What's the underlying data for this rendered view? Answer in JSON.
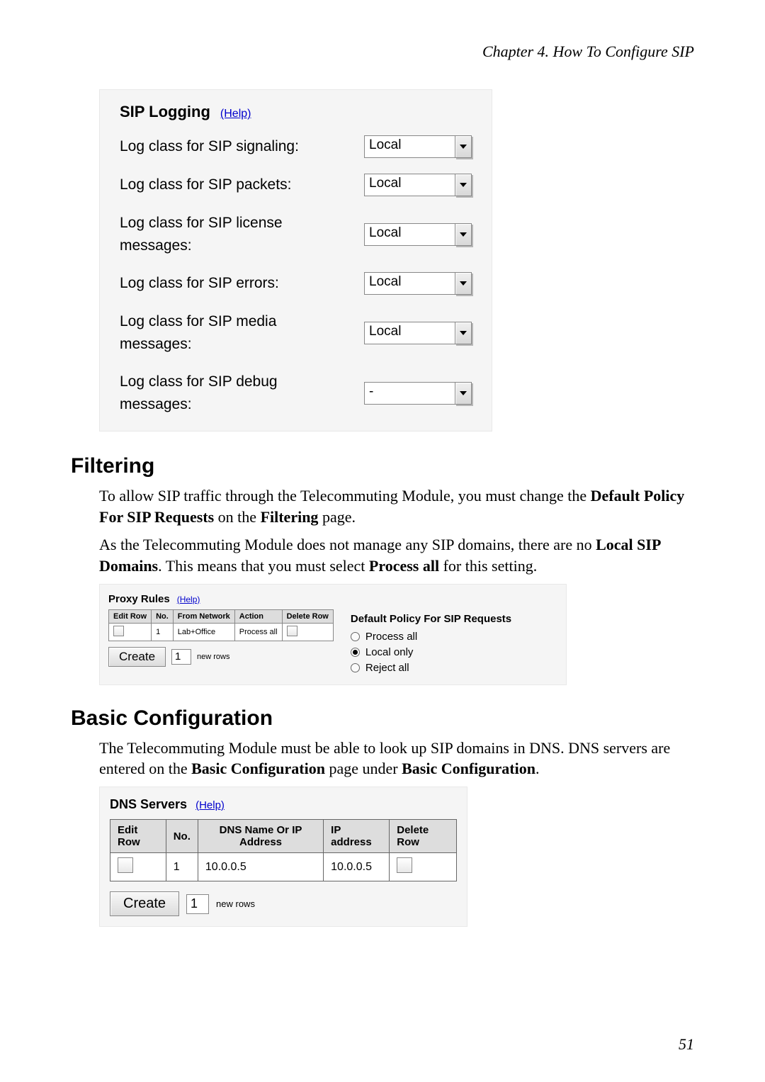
{
  "chapter": "Chapter 4. How To Configure SIP",
  "sip_logging": {
    "title": "SIP Logging",
    "help": "(Help)",
    "rows": [
      {
        "label": "Log class for SIP signaling:",
        "value": "Local"
      },
      {
        "label": "Log class for SIP packets:",
        "value": "Local"
      },
      {
        "label": "Log class for SIP license messages:",
        "value": "Local"
      },
      {
        "label": "Log class for SIP errors:",
        "value": "Local"
      },
      {
        "label": "Log class for SIP media messages:",
        "value": "Local"
      },
      {
        "label": "Log class for SIP debug messages:",
        "value": "-"
      }
    ]
  },
  "filtering": {
    "heading": "Filtering",
    "p1_a": "To allow SIP traffic through the Telecommuting Module, you must change the ",
    "p1_b": "Default Policy For SIP Requests",
    "p1_c": " on the ",
    "p1_d": "Filtering",
    "p1_e": " page.",
    "p2_a": "As the Telecommuting Module does not manage any SIP domains, there are no ",
    "p2_b": "Local SIP Domains",
    "p2_c": ". This means that you must select ",
    "p2_d": "Process all",
    "p2_e": " for this setting."
  },
  "proxy": {
    "title": "Proxy Rules",
    "help": "(Help)",
    "headers": {
      "edit": "Edit Row",
      "no": "No.",
      "from": "From Network",
      "action": "Action",
      "delete": "Delete Row"
    },
    "row": {
      "no": "1",
      "from": "Lab+Office",
      "action": "Process all"
    },
    "create": "Create",
    "create_num": "1",
    "newrows": "new rows",
    "policy_title": "Default Policy For SIP Requests",
    "opt_process": "Process all",
    "opt_local": "Local only",
    "opt_reject": "Reject all"
  },
  "basic": {
    "heading": "Basic Configuration",
    "p_a": "The Telecommuting Module must be able to look up SIP domains in DNS. DNS servers are entered on the ",
    "p_b": "Basic Configuration",
    "p_c": " page under ",
    "p_d": "Basic Configuration",
    "p_e": "."
  },
  "dns": {
    "title": "DNS Servers",
    "help": "(Help)",
    "headers": {
      "edit": "Edit Row",
      "no": "No.",
      "name": "DNS Name Or IP Address",
      "ip": "IP address",
      "delete": "Delete Row"
    },
    "row": {
      "no": "1",
      "name": "10.0.0.5",
      "ip": "10.0.0.5"
    },
    "create": "Create",
    "create_num": "1",
    "newrows": "new rows"
  },
  "page_number": "51"
}
